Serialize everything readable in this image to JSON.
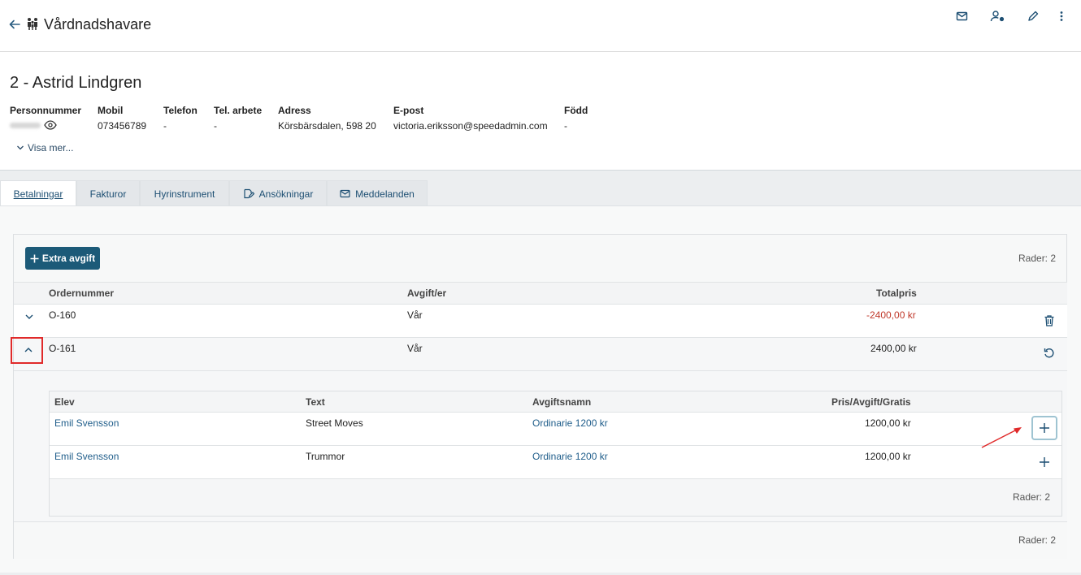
{
  "header": {
    "title": "Vårdnadshavare",
    "icons": [
      "arrow-left-icon",
      "people-icon",
      "mail-icon",
      "user-settings-icon",
      "pencil-icon",
      "more-vertical-icon"
    ]
  },
  "person": {
    "title": "2 - Astrid Lindgren",
    "fields": [
      {
        "label": "Personnummer",
        "value": ""
      },
      {
        "label": "Mobil",
        "value": "073456789"
      },
      {
        "label": "Telefon",
        "value": "-"
      },
      {
        "label": "Tel. arbete",
        "value": "-"
      },
      {
        "label": "Adress",
        "value": "Körsbärsdalen, 598 20"
      },
      {
        "label": "E-post",
        "value": "victoria.eriksson@speedadmin.com"
      },
      {
        "label": "Född",
        "value": "-"
      }
    ],
    "show_more": "Visa mer..."
  },
  "tabs": [
    {
      "label": "Betalningar",
      "active": true
    },
    {
      "label": "Fakturor"
    },
    {
      "label": "Hyrinstrument"
    },
    {
      "label": "Ansökningar",
      "icon": "edit-document-icon"
    },
    {
      "label": "Meddelanden",
      "icon": "mail-icon"
    }
  ],
  "payments": {
    "add_button": "Extra avgift",
    "rows_count": "Rader: 2",
    "columns": [
      "Ordernummer",
      "Avgift/er",
      "Totalpris"
    ],
    "rows": [
      {
        "order": "O-160",
        "fee": "Vår",
        "total": "-2400,00 kr",
        "action_icon": "trash-icon",
        "expanded": false
      },
      {
        "order": "O-161",
        "fee": "Vår",
        "total": "2400,00 kr",
        "action_icon": "undo-icon",
        "expanded": true
      }
    ],
    "sub_table": {
      "columns": [
        "Elev",
        "Text",
        "Avgiftsnamn",
        "Pris/Avgift/Gratis"
      ],
      "rows": [
        {
          "student": "Emil Svensson",
          "text": "Street Moves",
          "fee_name": "Ordinarie 1200 kr",
          "price": "1200,00 kr"
        },
        {
          "student": "Emil Svensson",
          "text": "Trummor",
          "fee_name": "Ordinarie 1200 kr",
          "price": "1200,00 kr"
        }
      ],
      "rows_count": "Rader: 2"
    },
    "footer_rows_count": "Rader: 2"
  },
  "colors": {
    "primary": "#1c5a78",
    "link": "#1f5d8a",
    "negative": "#c0392b",
    "highlight": "#e02a2a"
  }
}
